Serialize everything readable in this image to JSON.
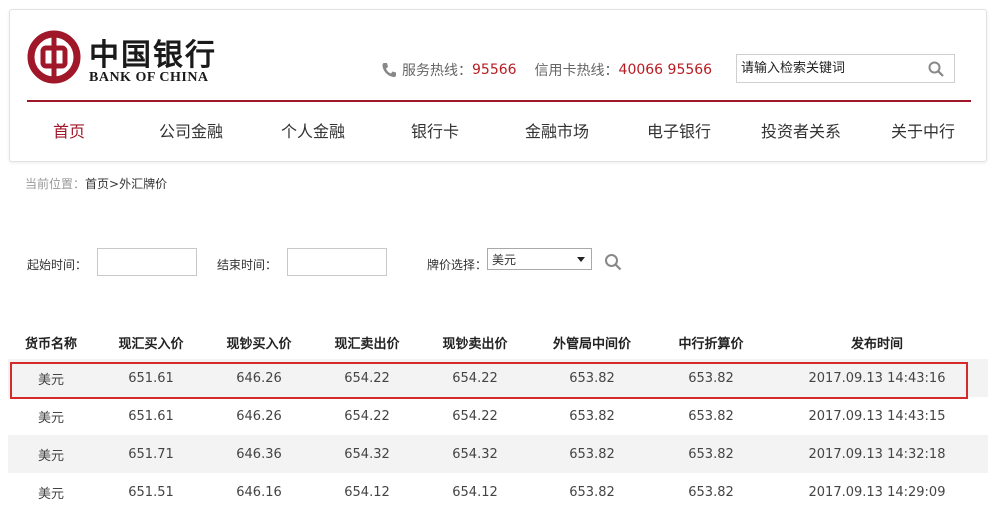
{
  "brand": {
    "name_cn": "中国银行",
    "name_en": "BANK OF CHINA",
    "color": "#a1172a"
  },
  "hotlines": {
    "service_label": "服务热线：",
    "service_number": "95566",
    "credit_label": "信用卡热线：",
    "credit_number": "40066 95566"
  },
  "search": {
    "placeholder": "请输入检索关键词",
    "icon": "search-icon"
  },
  "nav": {
    "items": [
      {
        "label": "首页",
        "active": true
      },
      {
        "label": "公司金融"
      },
      {
        "label": "个人金融"
      },
      {
        "label": "银行卡"
      },
      {
        "label": "金融市场"
      },
      {
        "label": "电子银行"
      },
      {
        "label": "投资者关系"
      },
      {
        "label": "关于中行"
      }
    ]
  },
  "breadcrumb": {
    "prefix": "当前位置：",
    "path": "首页>外汇牌价"
  },
  "filter": {
    "start_label": "起始时间：",
    "end_label": "结束时间：",
    "price_label": "牌价选择：",
    "currency_selected": "美元"
  },
  "table": {
    "headers": [
      "货币名称",
      "现汇买入价",
      "现钞买入价",
      "现汇卖出价",
      "现钞卖出价",
      "外管局中间价",
      "中行折算价",
      "发布时间"
    ],
    "rows": [
      [
        "美元",
        "651.61",
        "646.26",
        "654.22",
        "654.22",
        "653.82",
        "653.82",
        "2017.09.13 14:43:16"
      ],
      [
        "美元",
        "651.61",
        "646.26",
        "654.22",
        "654.22",
        "653.82",
        "653.82",
        "2017.09.13 14:43:15"
      ],
      [
        "美元",
        "651.71",
        "646.36",
        "654.32",
        "654.32",
        "653.82",
        "653.82",
        "2017.09.13 14:32:18"
      ],
      [
        "美元",
        "651.51",
        "646.16",
        "654.12",
        "654.12",
        "653.82",
        "653.82",
        "2017.09.13 14:29:09"
      ]
    ],
    "highlight_color": "#d42a2a"
  }
}
